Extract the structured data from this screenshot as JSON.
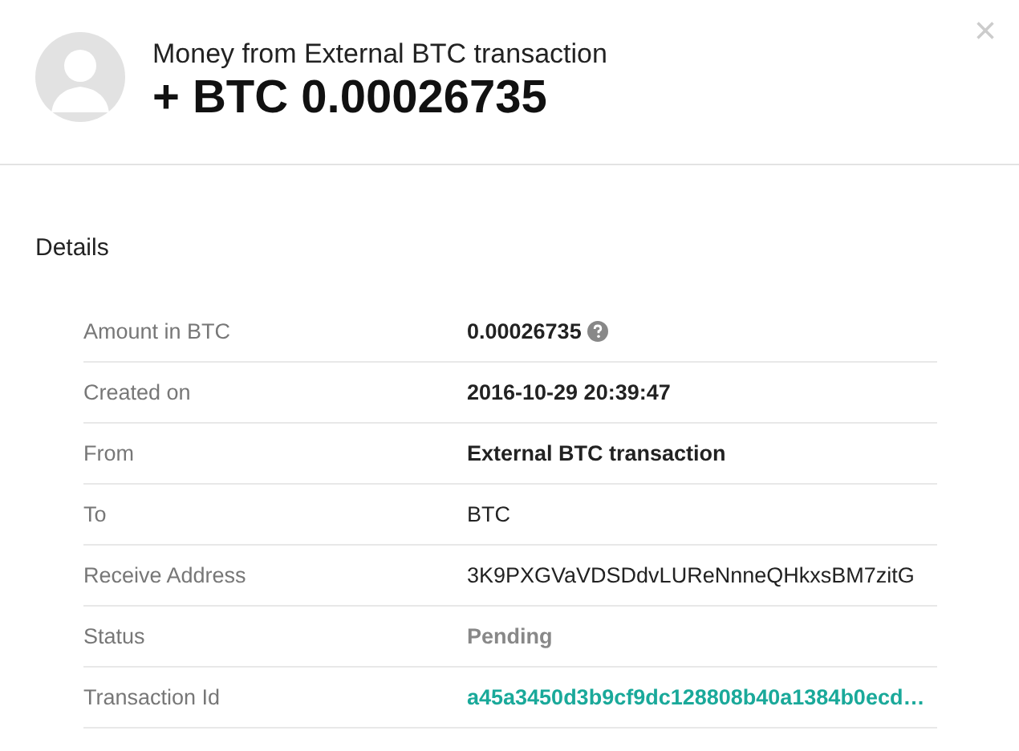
{
  "header": {
    "title": "Money from External BTC transaction",
    "amount": "+ BTC 0.00026735",
    "close": "×"
  },
  "details": {
    "heading": "Details",
    "rows": [
      {
        "label": "Amount in BTC",
        "value": "0.00026735",
        "kind": "strong",
        "help": true
      },
      {
        "label": "Created on",
        "value": "2016-10-29 20:39:47",
        "kind": "strong"
      },
      {
        "label": "From",
        "value": "External BTC transaction",
        "kind": "strong"
      },
      {
        "label": "To",
        "value": "BTC",
        "kind": "plain"
      },
      {
        "label": "Receive Address",
        "value": "3K9PXGVaVDSDdvLUReNnneQHkxsBM7zitG",
        "kind": "plain"
      },
      {
        "label": "Status",
        "value": "Pending",
        "kind": "muted"
      },
      {
        "label": "Transaction Id",
        "value": "a45a3450d3b9cf9dc128808b40a1384b0ecd…",
        "kind": "link"
      }
    ]
  }
}
